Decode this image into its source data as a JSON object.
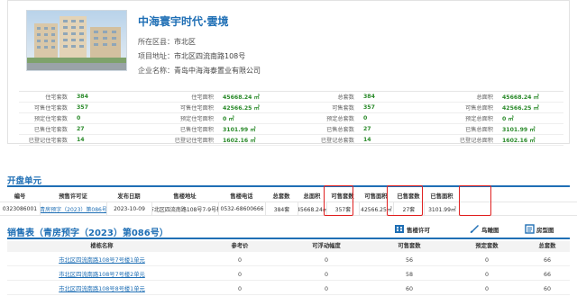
{
  "project": {
    "name": "中海寰宇时代·雲境",
    "district_label": "所在区县：",
    "district": "市北区",
    "address_label": "项目地址：",
    "address": "市北区四流南路108号",
    "company_label": "企业名称：",
    "company": "青岛中海海泰置业有限公司"
  },
  "stats": [
    {
      "k1": "住宅套数",
      "v1": "384",
      "k2": "住宅面积",
      "v2": "45668.24 ㎡",
      "k3": "总套数",
      "v3": "384",
      "k4": "总面积",
      "v4": "45668.24 ㎡"
    },
    {
      "k1": "可售住宅套数",
      "v1": "357",
      "k2": "可售住宅面积",
      "v2": "42566.25 ㎡",
      "k3": "可售套数",
      "v3": "357",
      "k4": "可售总面积",
      "v4": "42566.25 ㎡"
    },
    {
      "k1": "预定住宅套数",
      "v1": "0",
      "k2": "预定住宅面积",
      "v2": "0 ㎡",
      "k3": "预定总套数",
      "v3": "0",
      "k4": "预定总面积",
      "v4": "0 ㎡"
    },
    {
      "k1": "已售住宅套数",
      "v1": "27",
      "k2": "已售住宅面积",
      "v2": "3101.99 ㎡",
      "k3": "已售总套数",
      "v3": "27",
      "k4": "已售总面积",
      "v4": "3101.99 ㎡"
    },
    {
      "k1": "已登记住宅套数",
      "v1": "14",
      "k2": "已登记住宅面积",
      "v2": "1602.16 ㎡",
      "k3": "已登记总套数",
      "v3": "14",
      "k4": "已登记总面积",
      "v4": "1602.16 ㎡"
    }
  ],
  "units": {
    "title": "开盘单元",
    "headers": [
      "编号",
      "预售许可证",
      "发布日期",
      "售楼地址",
      "售楼电话",
      "总套数",
      "总面积",
      "可售套数",
      "可售面积",
      "已售套数",
      "已售面积"
    ],
    "row": [
      "0323086001",
      "青房预字（2023）第086号",
      "2023-10-09",
      "市北区四流南路108号7-9号楼",
      "0532-68600666",
      "384套",
      "45668.24㎡",
      "357套",
      "42566.25㎡",
      "27套",
      "3101.99㎡"
    ]
  },
  "sales": {
    "title": "销售表（青房预字（2023）第086号）",
    "tools": [
      "售楼许可",
      "鸟瞰图",
      "房型图"
    ],
    "headers": [
      "楼栋名称",
      "参考价",
      "可浮动幅度",
      "可售套数",
      "预定套数",
      "总套数"
    ],
    "rows": [
      [
        "市北区四流南路108号7号楼1单元",
        "0",
        "0",
        "56",
        "0",
        "66"
      ],
      [
        "市北区四流南路108号7号楼2单元",
        "0",
        "0",
        "58",
        "0",
        "66"
      ],
      [
        "市北区四流南路108号8号楼1单元",
        "0",
        "0",
        "60",
        "0",
        "60"
      ]
    ]
  },
  "colors": {
    "accent": "#1f6fb5",
    "highlight_box": "#e02020",
    "value_green": "#2a8a2a"
  }
}
